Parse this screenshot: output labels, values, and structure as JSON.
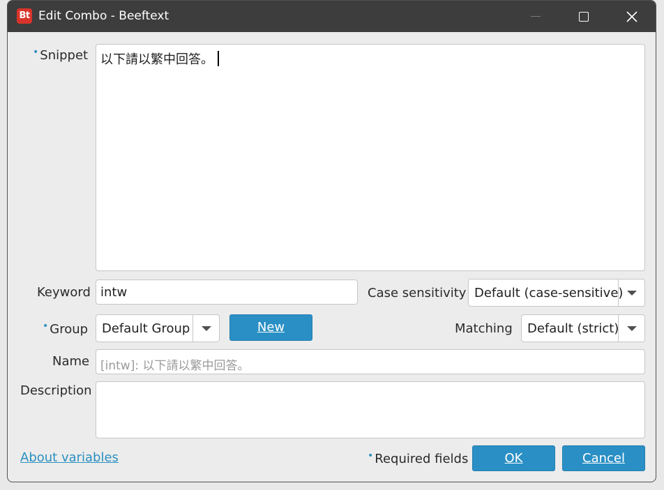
{
  "window": {
    "app_icon_text": "Bt",
    "title": "Edit Combo - Beeftext"
  },
  "form": {
    "snippet_label": "Snippet",
    "snippet_value": "以下請以繁中回答。",
    "keyword_label": "Keyword",
    "keyword_value": "intw",
    "case_label": "Case sensitivity",
    "case_value": "Default (case-sensitive)",
    "group_label": "Group",
    "group_value": "Default Group",
    "new_button": "New",
    "matching_label": "Matching",
    "matching_value": "Default (strict)",
    "name_label": "Name",
    "name_placeholder": "[intw]: 以下請以繁中回答。",
    "description_label": "Description",
    "description_value": ""
  },
  "footer": {
    "about_link": "About variables",
    "required_note": "Required fields",
    "ok_button": "OK",
    "cancel_button": "Cancel"
  },
  "colors": {
    "accent": "#2a8fc4",
    "titlebar": "#3d3d3d",
    "app_icon": "#d9342b"
  }
}
